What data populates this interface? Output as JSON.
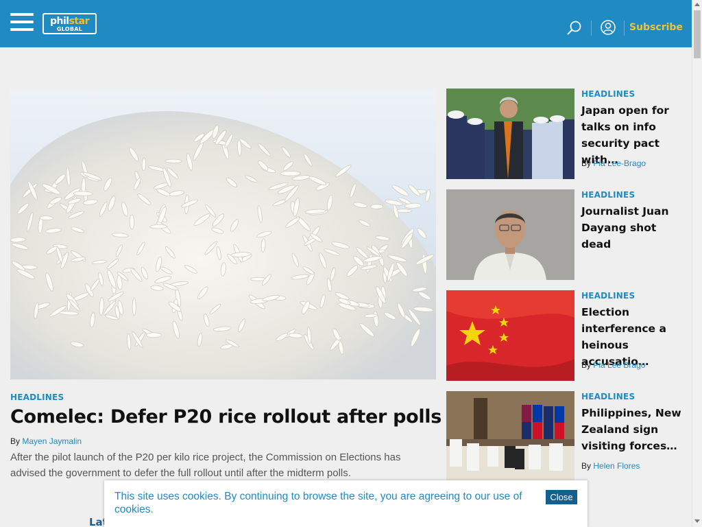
{
  "header": {
    "logo_line1_a": "phil",
    "logo_line1_b": "star",
    "logo_line2": "GLOBAL",
    "subscribe_label": "Subscribe",
    "icons": [
      "menu-icon",
      "search-icon",
      "user-icon"
    ]
  },
  "main_story": {
    "section": "HEADLINES",
    "title": "Comelec: Defer P20 rice rollout after polls",
    "byline_prefix": "By",
    "author": "Mayen Jaymalin",
    "summary": "After the pilot launch of the P20 per kilo rice project, the Commission on Elections  has advised the government to defer the full rollout until after the midterm polls."
  },
  "side_stories": [
    {
      "section": "HEADLINES",
      "title": "Japan open for talks on info security pact with…",
      "byline_prefix": "By",
      "author": "Pia Lee-Brago"
    },
    {
      "section": "HEADLINES",
      "title": "Journalist Juan Dayang shot dead",
      "byline_prefix": "",
      "author": ""
    },
    {
      "section": "HEADLINES",
      "title": "Election interference a heinous accusatio…",
      "byline_prefix": "By",
      "author": "Pia Lee Brago"
    },
    {
      "section": "HEADLINES",
      "title": "Philippines, New Zealand sign visiting forces…",
      "byline_prefix": "By",
      "author": "Helen Flores"
    }
  ],
  "latest_label": "Lat",
  "cookie": {
    "message": "This site uses cookies. By continuing to browse the site, you are agreeing to our use of cookies.",
    "close_label": "Close"
  },
  "colors": {
    "brand_blue": "#1f8bc2",
    "subscribe_yellow": "#f2c230",
    "close_button": "#145f8f"
  }
}
